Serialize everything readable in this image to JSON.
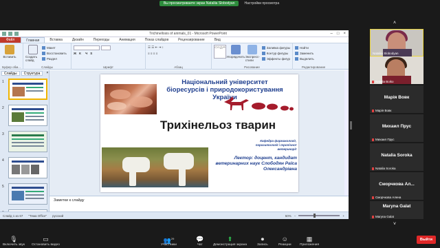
{
  "zoom_top": {
    "viewing_label": "Вы просматриваете экран Nataliia Slobodyan",
    "view_options": "Настройки просмотра"
  },
  "ppt": {
    "window_title": "Trichinellosis of animals_01 - Microsoft PowerPoint",
    "tabs": [
      "Файл",
      "Главная",
      "Вставка",
      "Дизайн",
      "Переходы",
      "Анимация",
      "Показ слайдов",
      "Рецензирование",
      "Вид"
    ],
    "ribbon": {
      "clipboard": {
        "label": "Буфер обм...",
        "paste": "Вставить"
      },
      "slides": {
        "label": "Слайды",
        "create": "Создать слайд",
        "layout": "Макет",
        "reset": "Восстановить",
        "section": "Раздел"
      },
      "font": {
        "label": "Шрифт"
      },
      "paragraph": {
        "label": "Абзац"
      },
      "drawing": {
        "label": "Рисование",
        "arrange": "Упорядочить",
        "quick_styles": "Экспресс-стили",
        "fill": "Заливка фигуры",
        "outline": "Контур фигуры",
        "effects": "Эффекты фигур"
      },
      "editing": {
        "label": "Редактирование",
        "find": "Найти",
        "replace": "Заменить",
        "select": "Выделить"
      }
    },
    "thumb_tabs": {
      "slides": "Слайды",
      "outline": "Структура",
      "close": "×"
    },
    "thumb_numbers": [
      "1",
      "2",
      "3",
      "4",
      "5",
      "6"
    ],
    "slide": {
      "university": "Національний університет біоресурсів і природокористування України",
      "main_title": "Трихінельоз тварин",
      "department": "Кафедра фармакології, паразитології і тропічної ветеринарії",
      "lecturer": "Лектор: доцент, кандидат ветеринарних наук Слободян Раїса Олександрівна"
    },
    "notes": "Заметки к слайду",
    "status": {
      "slide_of": "Слайд 1 из 67",
      "theme": "\"Тема Office\"",
      "language": "русский",
      "zoom": "50%"
    }
  },
  "gallery": [
    {
      "name": "Nataliia Slobodyan",
      "type": "video"
    },
    {
      "name": "Natalia Boiko",
      "type": "video"
    },
    {
      "display": "Марія Вовк",
      "name": "Марія Вовк",
      "type": "name"
    },
    {
      "display": "Михаил Прус",
      "name": "Михаил Прус",
      "type": "name"
    },
    {
      "display": "Natalia Soroka",
      "name": "Natalia Soroka",
      "type": "name"
    },
    {
      "display": "Сморчкова Ал...",
      "name": "Сморчкова Алена",
      "type": "name"
    },
    {
      "display": "Maryna Galat",
      "name": "Maryna Galat",
      "type": "name"
    }
  ],
  "toolbar": {
    "unmute": "Включить звук",
    "stop_video": "Остановить видео",
    "participants": "Участники",
    "participants_count": "29",
    "chat": "Чат",
    "share": "Демонстрация экрана",
    "record": "Запись",
    "reactions": "Реакции",
    "apps": "Приложения",
    "leave": "Выйти",
    "tooltip": "Выключить видео (Alt+V)"
  }
}
